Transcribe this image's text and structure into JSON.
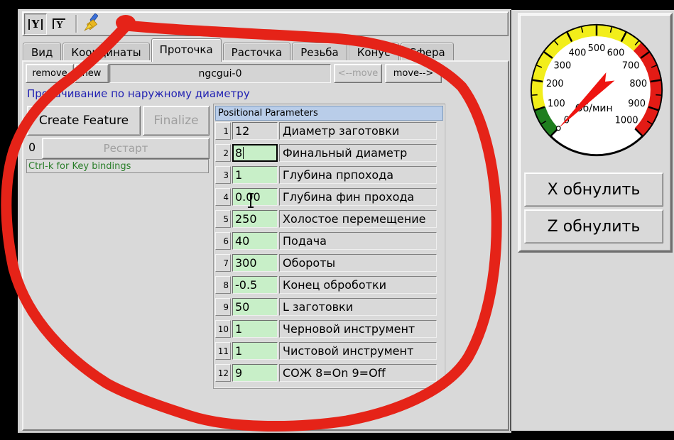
{
  "window": {
    "toolbar": {
      "icons": [
        {
          "name": "font-increase-Y",
          "pressed": true
        },
        {
          "name": "font-decrease-Y",
          "pressed": false
        },
        {
          "name": "clear-brush",
          "pressed": false
        }
      ]
    },
    "tabs": [
      "Вид",
      "Координаты",
      "Проточка",
      "Расточка",
      "Резьба",
      "Конус",
      "Сфера"
    ],
    "selected_tab": "Проточка",
    "file_bar": {
      "remove": "remove",
      "new": "new",
      "tab_entry": "ngcgui-0",
      "move_left": "<--move",
      "move_right": "move-->"
    },
    "caption": "Протачивание по наружному диаметру",
    "controls": {
      "create_feature": "Create Feature",
      "finalize": "Finalize",
      "feature_count": "0",
      "restart": "Рестарт",
      "key_hint": "Ctrl-k for Key bindings"
    },
    "params": {
      "header": "Positional Parameters",
      "focused_param": "2",
      "rows": [
        {
          "num": "1",
          "value": "12",
          "label": "Диаметр заготовки"
        },
        {
          "num": "2",
          "value": "8",
          "label": "Финальный диаметр"
        },
        {
          "num": "3",
          "value": "1",
          "label": "Глубина прпохода"
        },
        {
          "num": "4",
          "value": "0.00",
          "label": "Глубина фин прохода"
        },
        {
          "num": "5",
          "value": "250",
          "label": "Холостое перемещение"
        },
        {
          "num": "6",
          "value": "40",
          "label": "Подача"
        },
        {
          "num": "7",
          "value": "300",
          "label": "Обороты"
        },
        {
          "num": "8",
          "value": "-0.5",
          "label": "Конец оброботки"
        },
        {
          "num": "9",
          "value": "50",
          "label": "L заготовки"
        },
        {
          "num": "10",
          "value": "1",
          "label": "Черновой инструмент"
        },
        {
          "num": "11",
          "value": "1",
          "label": "Чистовой инструмент"
        },
        {
          "num": "12",
          "value": "9",
          "label": "СОЖ 8=On 9=Off"
        }
      ]
    }
  },
  "right_panel": {
    "gauge": {
      "unit_label": "Об/мин",
      "min": 0,
      "max": 1000,
      "major_step": 100,
      "minor_step": 50,
      "value": 0,
      "needle_color": "#ee1410",
      "bands": [
        {
          "from": 0,
          "to": 100,
          "color": "#1e7e1e"
        },
        {
          "from": 100,
          "to": 660,
          "color": "#f2ee1a"
        },
        {
          "from": 660,
          "to": 1000,
          "color": "#e31b15"
        }
      ]
    },
    "buttons": [
      {
        "label": "X обнулить"
      },
      {
        "label": "Z обнулить"
      }
    ]
  },
  "annotation": {
    "color": "#e52318"
  }
}
